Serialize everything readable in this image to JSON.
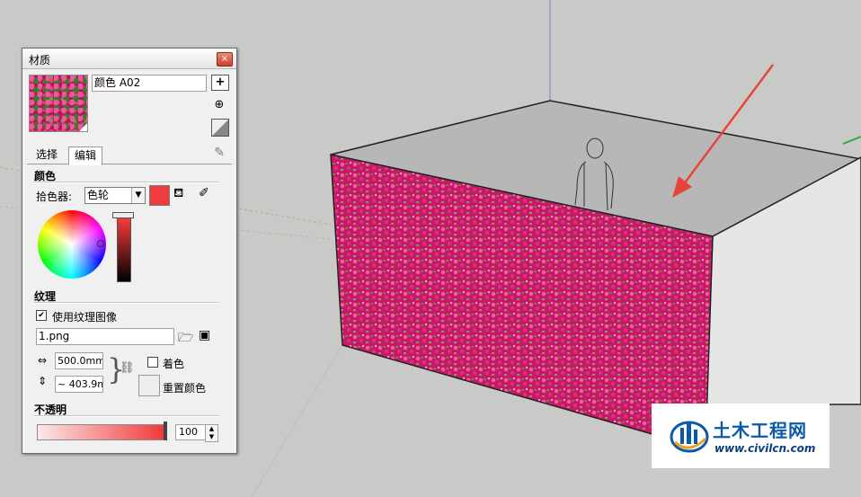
{
  "panel": {
    "title": "材质",
    "close_label": "×",
    "material_name": "颜色 A02",
    "tabs": [
      {
        "label": "选择"
      },
      {
        "label": "编辑"
      }
    ],
    "color": {
      "heading": "颜色",
      "picker_label": "拾色器:",
      "picker_value": "色轮",
      "current_color": "#f03c3c"
    },
    "texture": {
      "heading": "纹理",
      "use_texture_label": "使用纹理图像",
      "use_texture_checked": true,
      "file": "1.png",
      "width": "500.0mm",
      "height": "~ 403.9m",
      "colorize_label": "着色",
      "reset_label": "重置颜色"
    },
    "opacity": {
      "heading": "不透明",
      "value": "100"
    }
  },
  "watermark": {
    "name": "土木工程网",
    "url": "www.civilcn.com"
  },
  "colors": {
    "background": "#c9c9c7",
    "roof": "#b7b7b7",
    "side_wall": "#e6e6e6",
    "texture_pink": "#c8186a",
    "arrow": "#e8453a"
  },
  "icons": {
    "create": "create-material-icon",
    "paint": "paint-bucket-icon",
    "sample": "sample-paint-icon",
    "eyedropper": "eyedropper-icon"
  }
}
